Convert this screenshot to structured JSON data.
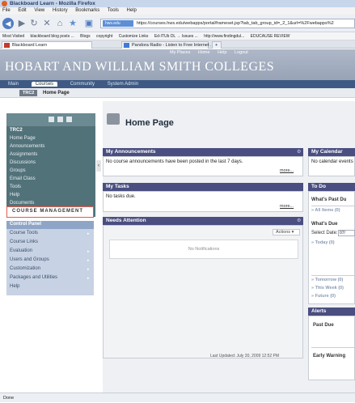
{
  "window": {
    "title": "Blackboard Learn - Mozilla Firefox"
  },
  "menu": [
    "File",
    "Edit",
    "View",
    "History",
    "Bookmarks",
    "Tools",
    "Help"
  ],
  "nav": {
    "badge": "hws.edu",
    "url": "https://courses.hws.edu/webapps/portal/frameset.jsp?tab_tab_group_id=_2_1&url=%2Fwebapps%2"
  },
  "bookmarks": [
    "Most Visited",
    "blackboard blog posts ...",
    "Blogs",
    "copyright",
    "Customize Links",
    "Ed-ITUb DL → Issues ...",
    "http://www.findingdul...",
    "EDUCAUSE REVIEW"
  ],
  "tabs": [
    "Blackboard Learn",
    "Pandora Radio - Listen to Free Internet ...",
    "+"
  ],
  "header": {
    "college": "HOBART AND WILLIAM SMITH COLLEGES",
    "links": [
      "My Places",
      "Home",
      "Help",
      "Logout"
    ]
  },
  "subtabs": [
    "Main",
    "Courses",
    "Community",
    "System Admin"
  ],
  "crumbs": {
    "course": "TRC2",
    "page": "Home Page"
  },
  "course_menu": {
    "title": "TRC2",
    "items": [
      "Home Page",
      "Announcements",
      "Assignments",
      "Discussions",
      "Groups",
      "Email Class",
      "Tools",
      "Help",
      "Documents"
    ]
  },
  "management": {
    "label": "COURSE MANAGEMENT",
    "panel_title": "Control Panel",
    "items": [
      "Course Tools",
      "Course Links",
      "Evaluation",
      "Users and Groups",
      "Customization",
      "Packages and Utilities",
      "Help"
    ]
  },
  "content": {
    "title": "Home Page",
    "announcements": {
      "title": "My Announcements",
      "text": "No course announcements have been posted in the last 7 days.",
      "more": "more..."
    },
    "tasks": {
      "title": "My Tasks",
      "text": "No tasks due.",
      "more": "more..."
    },
    "attention": {
      "title": "Needs Attention",
      "actions": "Actions",
      "empty": "No Notifications",
      "updated": "Last Updated: July 30, 2009 12:52 PM"
    },
    "calendar": {
      "title": "My Calendar",
      "text": "No calendar events"
    },
    "todo": {
      "title": "To Do",
      "past_due": "What's Past Du",
      "all_items": "» All Items (0)",
      "whats_due": "What's Due",
      "select_date": "Select Date:",
      "date_value": "07/",
      "today": "» Today (0)",
      "tomorrow": "» Tomorrow (0)",
      "this_week": "» This Week (0)",
      "future": "» Future (0)"
    },
    "alerts": {
      "title": "Alerts",
      "past_due": "Past Due",
      "early_warning": "Early Warning"
    }
  },
  "status": "Done"
}
